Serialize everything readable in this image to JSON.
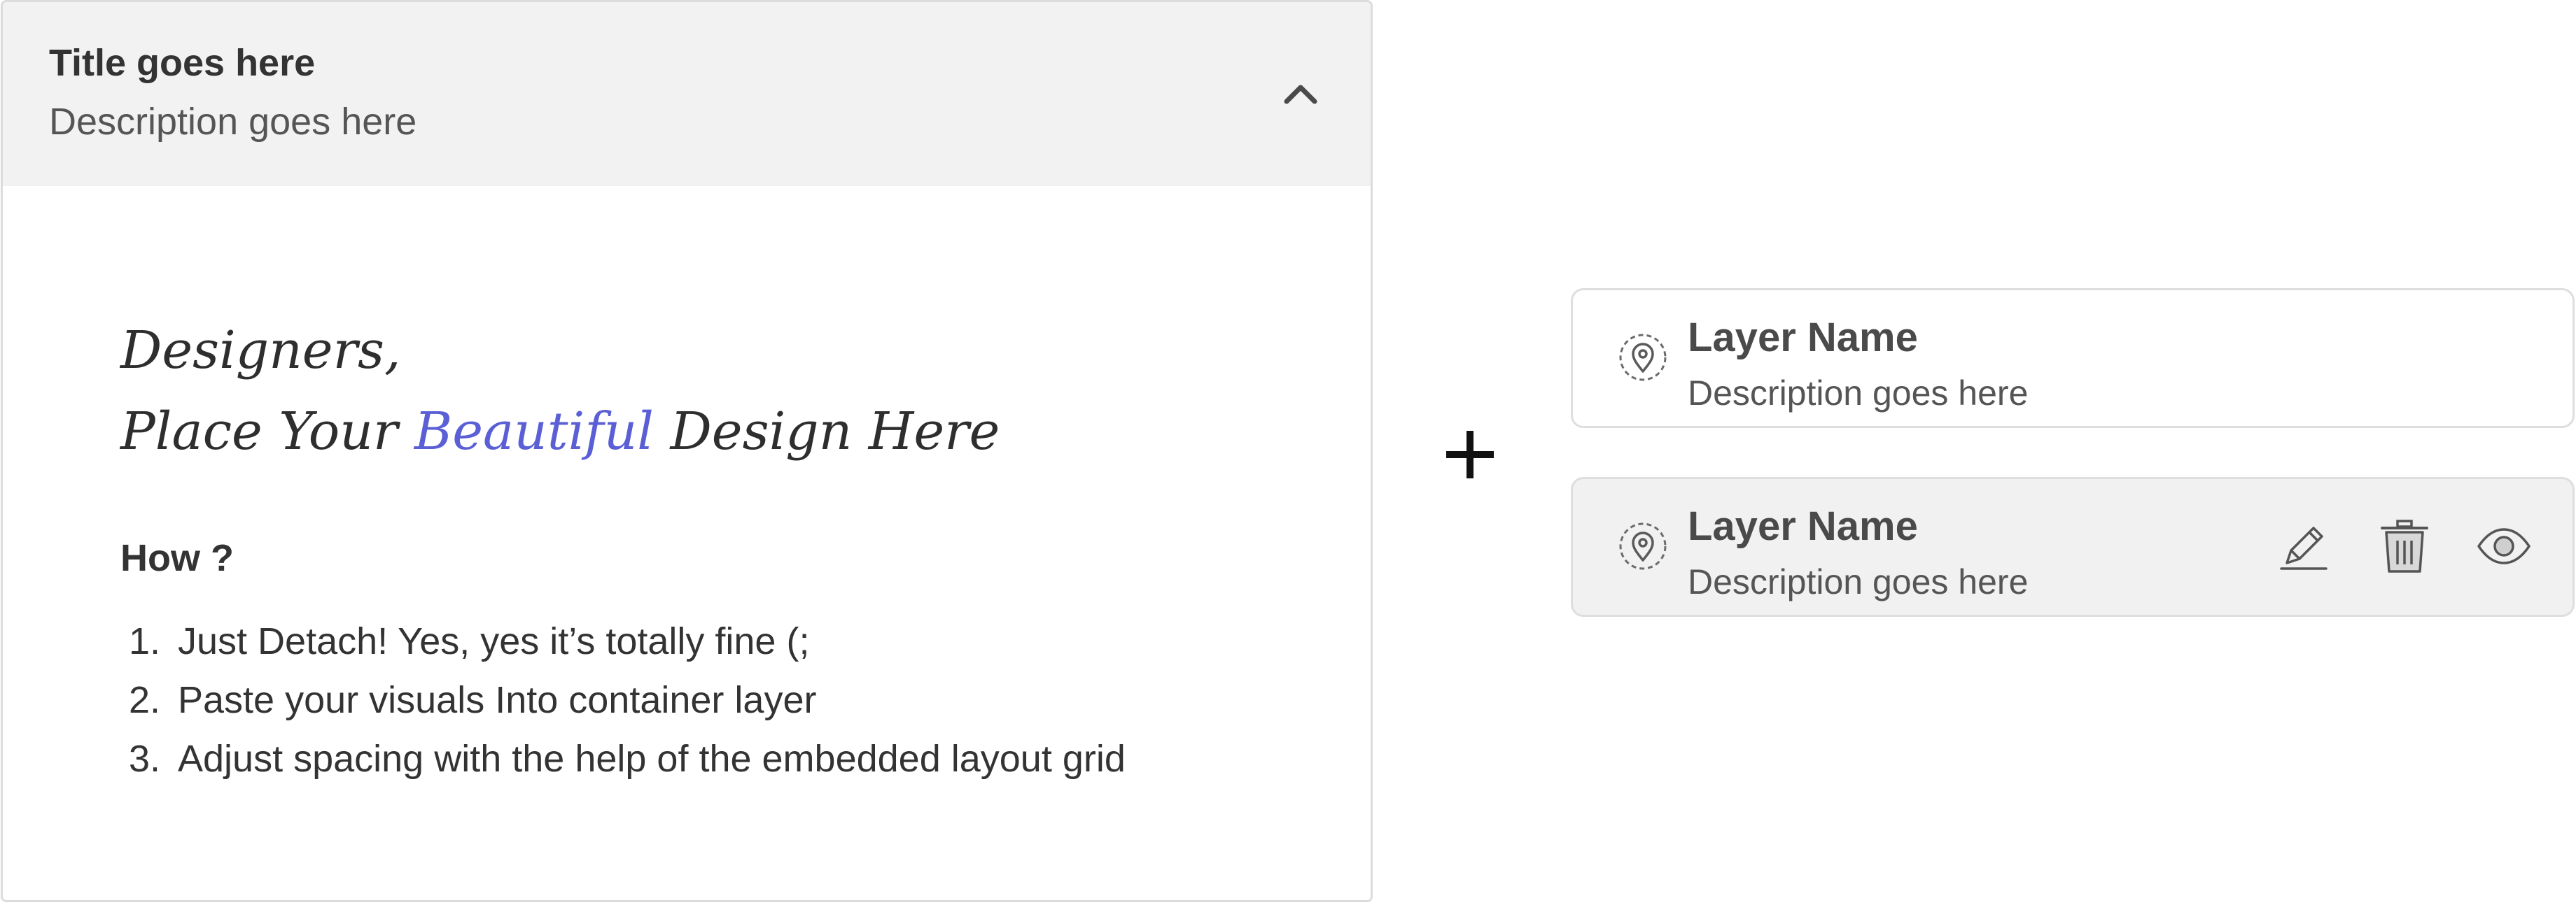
{
  "accordion": {
    "title": "Title goes here",
    "description": "Description goes here",
    "toggle_icon": "chevron-up-icon",
    "content": {
      "line1": "Designers,",
      "line2_before": "Place Your ",
      "line2_accent": "Beautiful",
      "line2_after": " Design Here",
      "accent_color": "#5b5fd6",
      "how_heading": "How ?",
      "steps": [
        {
          "num": "1.",
          "text": "Just Detach! Yes, yes it’s totally fine (;"
        },
        {
          "num": "2.",
          "text": "Paste your visuals Into container layer"
        },
        {
          "num": "3.",
          "text": "Adjust spacing with the help of the embedded layout grid"
        }
      ]
    }
  },
  "plus_icon": "plus-icon",
  "layers": [
    {
      "name": "Layer Name",
      "description": "Description goes here",
      "icon": "location-pin-icon",
      "state": "default"
    },
    {
      "name": "Layer Name",
      "description": "Description goes here",
      "icon": "location-pin-icon",
      "state": "hover",
      "actions": [
        "pencil-icon",
        "trash-icon",
        "eye-icon"
      ]
    }
  ]
}
